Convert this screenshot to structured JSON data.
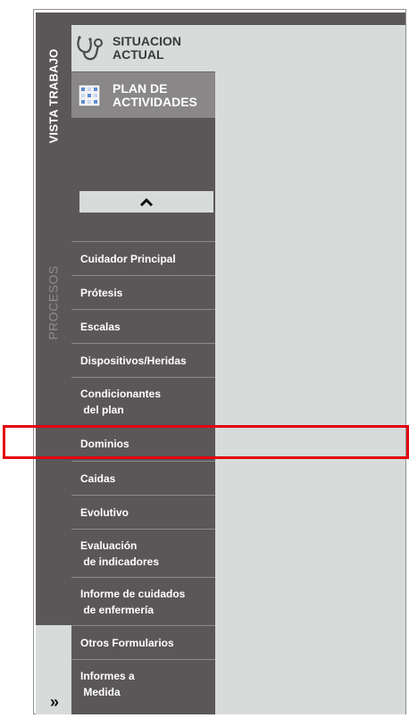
{
  "rail": {
    "vista_label": "VISTA TRABAJO",
    "procesos_label": "PROCESOS",
    "expand_glyph": "»"
  },
  "tabs": [
    {
      "label": "SITUACION\nACTUAL",
      "icon": "stethoscope-icon"
    },
    {
      "label": "PLAN DE\nACTIVIDADES",
      "icon": "calendar-grid-icon"
    }
  ],
  "collapse_glyph": "^",
  "menu": [
    {
      "label": "Cuidador Principal"
    },
    {
      "label": "Prótesis"
    },
    {
      "label": "Escalas"
    },
    {
      "label": "Dispositivos/Heridas"
    },
    {
      "label": "Condicionantes\n del plan"
    },
    {
      "label": "Dominios",
      "highlighted": true
    },
    {
      "label": "Caidas"
    },
    {
      "label": "Evolutivo"
    },
    {
      "label": "Evaluación\n de indicadores"
    },
    {
      "label": "Informe de cuidados\n de enfermería"
    },
    {
      "label": "Otros Formularios"
    },
    {
      "label": "Informes a\n Medida"
    }
  ],
  "colors": {
    "sidebar_bg": "#5b5759",
    "panel_bg": "#d7dbd9",
    "highlight": "#e3000f",
    "menu_text": "#ffffff"
  }
}
